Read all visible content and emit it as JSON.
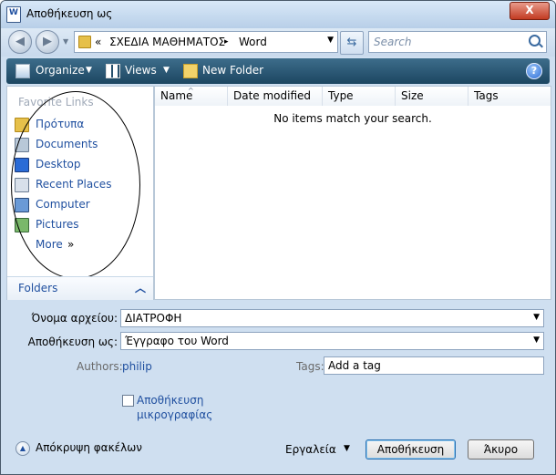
{
  "window": {
    "title": "Αποθήκευση ως",
    "close_glyph": "X"
  },
  "address": {
    "back_icon": "back-arrow-icon",
    "forward_icon": "forward-arrow-icon",
    "chevron": "«",
    "crumbs": [
      "ΣΧΕΔΙΑ ΜΑΘΗΜΑΤΟΣ",
      "Word"
    ],
    "separator": "▸",
    "search_placeholder": "Search"
  },
  "toolbar": {
    "organize": "Organize",
    "views": "Views",
    "new_folder": "New Folder",
    "help": "?"
  },
  "nav": {
    "header": "Favorite Links",
    "links": [
      "Πρότυπα",
      "Documents",
      "Desktop",
      "Recent Places",
      "Computer",
      "Pictures"
    ],
    "more": "More",
    "more_chevron": "»",
    "folders": "Folders"
  },
  "files": {
    "columns": [
      "Name",
      "Date modified",
      "Type",
      "Size",
      "Tags"
    ],
    "empty_message": "No items match your search."
  },
  "form": {
    "filename_label": "Όνομα αρχείου:",
    "filename_value": "ΔΙΑΤΡΟΦΗ",
    "savetype_label": "Αποθήκευση ως:",
    "savetype_value": "Έγγραφο του Word",
    "authors_label": "Authors:",
    "authors_value": "philip",
    "tags_label": "Tags:",
    "tags_placeholder": "Add a tag",
    "thumbnail_label": "Αποθήκευση μικρογραφίας",
    "thumbnail_checked": false
  },
  "footer": {
    "hide_folders": "Απόκρυψη φακέλων",
    "tools": "Εργαλεία",
    "save_button": "Αποθήκευση",
    "cancel_button": "Άκυρο"
  }
}
